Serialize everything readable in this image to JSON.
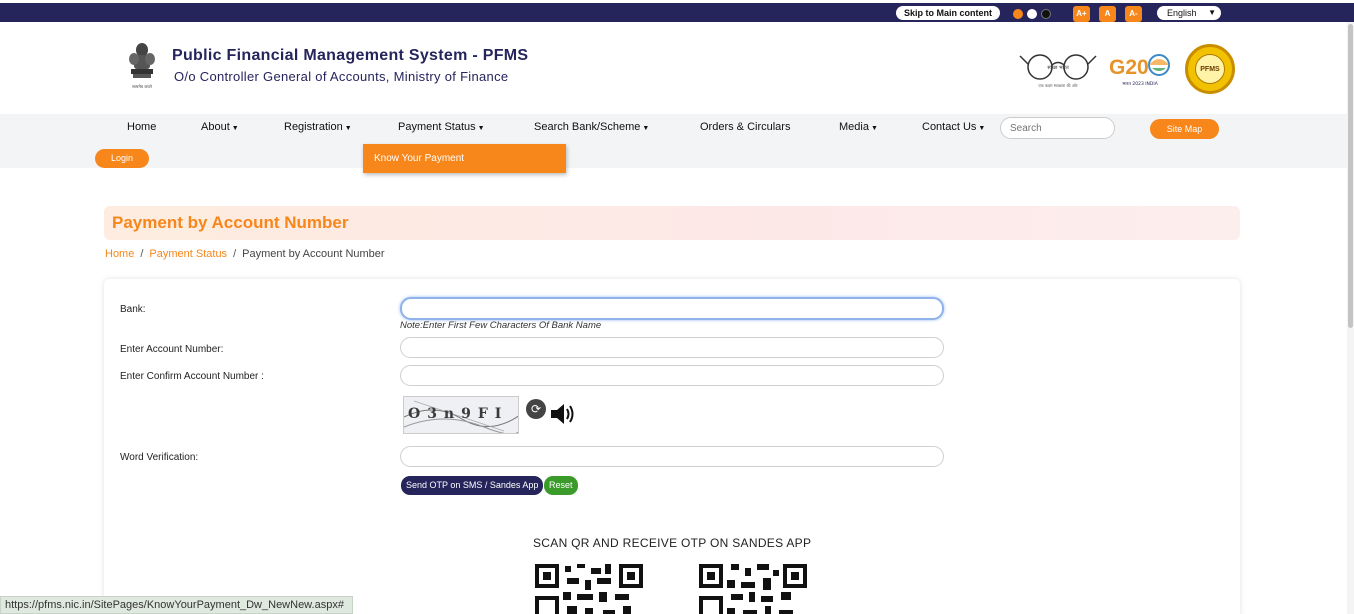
{
  "topbar": {
    "skip_label": "Skip to Main content",
    "font_sizes": [
      "A+",
      "A",
      "A-"
    ],
    "language": "English",
    "colors": {
      "bar": "#25255c",
      "accent": "#f7861b"
    }
  },
  "header": {
    "title": "Public Financial Management System - PFMS",
    "subtitle": "O/o Controller General of Accounts, Ministry of Finance",
    "emblem_caption": "सत्यमेव जयते",
    "swachh_text": "स्वच्छ भारत",
    "swachh_tagline": "एक कदम स्वच्छता की ओर",
    "g20_label": "G20",
    "g20_sub": "भारत 2023 INDIA",
    "seal_label": "PFMS"
  },
  "nav": {
    "items": [
      {
        "label": "Home"
      },
      {
        "label": "About",
        "dropdown": true
      },
      {
        "label": "Registration",
        "dropdown": true
      },
      {
        "label": "Payment Status",
        "dropdown": true
      },
      {
        "label": "Search Bank/Scheme",
        "dropdown": true
      },
      {
        "label": "Orders & Circulars"
      },
      {
        "label": "Media",
        "dropdown": true
      },
      {
        "label": "Contact Us",
        "dropdown": true
      }
    ],
    "search_placeholder": "Search",
    "sitemap_label": "Site Map",
    "login_label": "Login",
    "open_dropdown": {
      "parent": "Payment Status",
      "item": "Know Your Payment"
    }
  },
  "page": {
    "title": "Payment by Account Number",
    "breadcrumb": [
      "Home",
      "Payment Status",
      "Payment by Account Number"
    ]
  },
  "form": {
    "bank_label": "Bank:",
    "bank_value": "",
    "bank_note": "Note:Enter First Few Characters Of Bank Name",
    "account_label": "Enter Account Number:",
    "account_value": "",
    "confirm_label": "Enter Confirm Account Number :",
    "confirm_value": "",
    "captcha_text": "O3n9FI",
    "word_label": "Word Verification:",
    "word_value": "",
    "otp_button": "Send OTP on SMS / Sandes App",
    "reset_button": "Reset",
    "qr_heading": "SCAN QR AND RECEIVE OTP ON SANDES APP"
  },
  "status_bar": {
    "url": "https://pfms.nic.in/SitePages/KnowYourPayment_Dw_NewNew.aspx#"
  }
}
